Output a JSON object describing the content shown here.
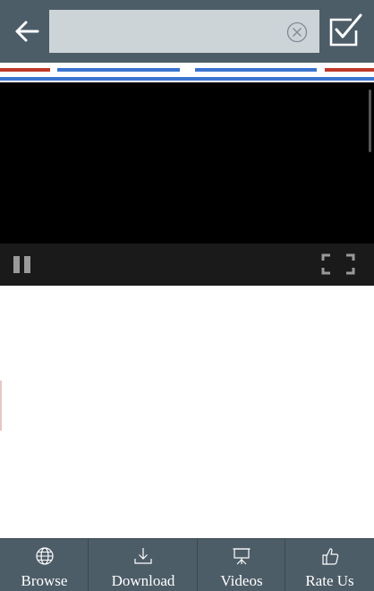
{
  "header": {
    "back_icon": "arrow-left-icon",
    "search": {
      "value": "",
      "placeholder": ""
    },
    "clear_icon": "circle-x-icon",
    "confirm_icon": "checkbox-checked-icon"
  },
  "colors": {
    "header_bg": "#4d5d68",
    "search_bg": "#cdd4d8",
    "stripe_red": "#c0392b",
    "stripe_blue": "#3a74d0",
    "video_bg": "#000000",
    "control_bar_bg": "#1a1a1a"
  },
  "video": {
    "pause_icon": "pause-icon",
    "fullscreen_icon": "fullscreen-icon"
  },
  "bottom_nav": {
    "items": [
      {
        "label": "Browse",
        "icon": "globe-icon"
      },
      {
        "label": "Download",
        "icon": "download-icon"
      },
      {
        "label": "Videos",
        "icon": "projector-icon"
      },
      {
        "label": "Rate Us",
        "icon": "thumbs-up-icon"
      }
    ]
  }
}
